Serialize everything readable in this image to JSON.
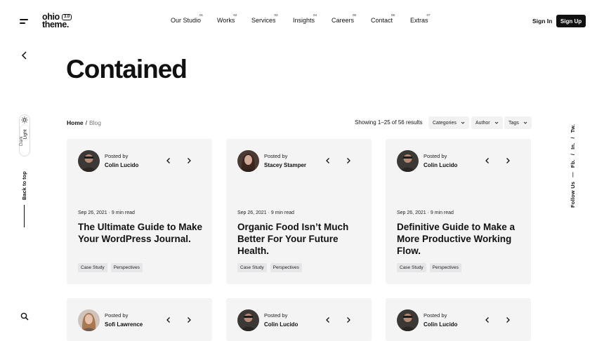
{
  "header": {
    "logo_line1": "ohio",
    "logo_line2": "theme.",
    "logo_version": "3.0",
    "nav": [
      {
        "num": "01",
        "label": "Our Studio"
      },
      {
        "num": "02",
        "label": "Works"
      },
      {
        "num": "03",
        "label": "Services"
      },
      {
        "num": "04",
        "label": "Insights"
      },
      {
        "num": "05",
        "label": "Careers"
      },
      {
        "num": "06",
        "label": "Contact"
      },
      {
        "num": "07",
        "label": "Extras"
      }
    ],
    "sign_in": "Sign In",
    "sign_up": "Sign Up"
  },
  "left_rail": {
    "theme_light": "Light",
    "theme_dark": "Dark",
    "back_to_top": "Back to top"
  },
  "right_rail": {
    "follow_label": "Follow Us",
    "dash": "—",
    "links": [
      "Fb.",
      "/",
      "In.",
      "/",
      "Tw."
    ]
  },
  "page": {
    "title": "Contained",
    "breadcrumb_home": "Home",
    "breadcrumb_sep": "/",
    "breadcrumb_current": "Blog",
    "results": "Showing 1–25 of 56 results",
    "filters": [
      "Categories",
      "Author",
      "Tags"
    ]
  },
  "cards": [
    {
      "posted_by": "Posted by",
      "author": "Colin Lucido",
      "meta": "Sep 26, 2021 · 9 min read",
      "title": "The Ultimate Guide to Make Your WordPress Journal.",
      "tags": [
        "Case Study",
        "Perspectives"
      ]
    },
    {
      "posted_by": "Posted by",
      "author": "Stacey Stamper",
      "meta": "Sep 26, 2021 · 9 min read",
      "title": "Organic Food Isn’t Much Better For Your Future Health.",
      "tags": [
        "Case Study",
        "Perspectives"
      ]
    },
    {
      "posted_by": "Posted by",
      "author": "Colin Lucido",
      "meta": "Sep 26, 2021 · 9 min read",
      "title": "Definitive Guide to Make a More Productive Working Flow.",
      "tags": [
        "Case Study",
        "Perspectives"
      ]
    },
    {
      "posted_by": "Posted by",
      "author": "Sofi Lawrence"
    },
    {
      "posted_by": "Posted by",
      "author": "Colin Lucido"
    },
    {
      "posted_by": "Posted by",
      "author": "Colin Lucido"
    }
  ],
  "colors": {
    "accent": "#111111",
    "card_bg": "#f4f4f5",
    "tag_bg": "#e6e6e8"
  }
}
